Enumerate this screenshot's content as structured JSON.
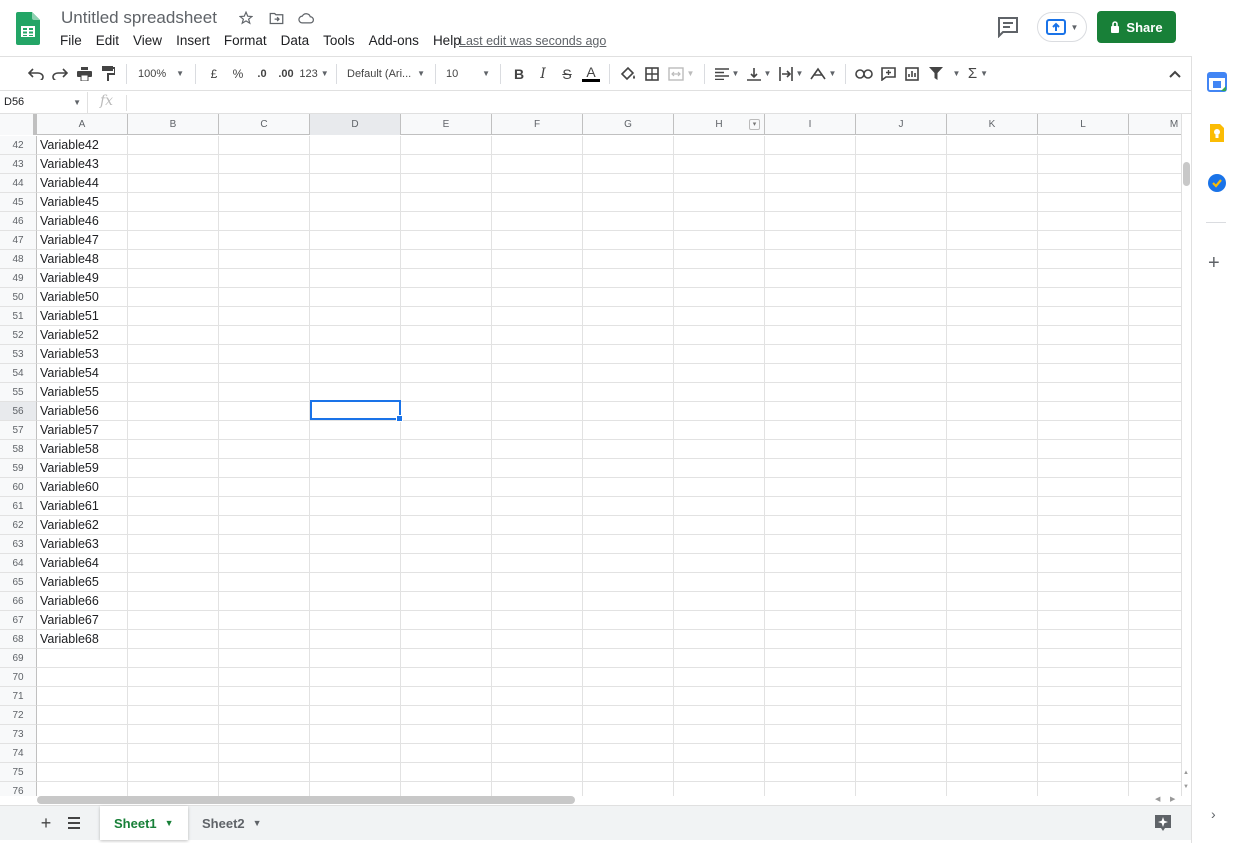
{
  "header": {
    "doc_title": "Untitled spreadsheet",
    "last_edit": "Last edit was seconds ago",
    "share_label": "Share",
    "menu": [
      "File",
      "Edit",
      "View",
      "Insert",
      "Format",
      "Data",
      "Tools",
      "Add-ons",
      "Help"
    ]
  },
  "toolbar": {
    "zoom": "100%",
    "currency": "£",
    "percent": "%",
    "decrease_decimal": ".0",
    "increase_decimal": ".00",
    "more_formats": "123",
    "font": "Default (Ari...",
    "font_size": "10",
    "bold": "B",
    "italic": "I",
    "strike": "S",
    "text_color": "A",
    "sum": "Σ"
  },
  "formula_bar": {
    "name_box": "D56",
    "fx": "fx"
  },
  "grid": {
    "columns": [
      "A",
      "B",
      "C",
      "D",
      "E",
      "F",
      "G",
      "H",
      "I",
      "J",
      "K",
      "L",
      "M"
    ],
    "active_column": "D",
    "filter_column": "H",
    "active_row": 56,
    "rows": [
      {
        "num": "42",
        "a": "Variable42"
      },
      {
        "num": "43",
        "a": "Variable43"
      },
      {
        "num": "44",
        "a": "Variable44"
      },
      {
        "num": "45",
        "a": "Variable45"
      },
      {
        "num": "46",
        "a": "Variable46"
      },
      {
        "num": "47",
        "a": "Variable47"
      },
      {
        "num": "48",
        "a": "Variable48"
      },
      {
        "num": "49",
        "a": "Variable49"
      },
      {
        "num": "50",
        "a": "Variable50"
      },
      {
        "num": "51",
        "a": "Variable51"
      },
      {
        "num": "52",
        "a": "Variable52"
      },
      {
        "num": "53",
        "a": "Variable53"
      },
      {
        "num": "54",
        "a": "Variable54"
      },
      {
        "num": "55",
        "a": "Variable55"
      },
      {
        "num": "56",
        "a": "Variable56"
      },
      {
        "num": "57",
        "a": "Variable57"
      },
      {
        "num": "58",
        "a": "Variable58"
      },
      {
        "num": "59",
        "a": "Variable59"
      },
      {
        "num": "60",
        "a": "Variable60"
      },
      {
        "num": "61",
        "a": "Variable61"
      },
      {
        "num": "62",
        "a": "Variable62"
      },
      {
        "num": "63",
        "a": "Variable63"
      },
      {
        "num": "64",
        "a": "Variable64"
      },
      {
        "num": "65",
        "a": "Variable65"
      },
      {
        "num": "66",
        "a": "Variable66"
      },
      {
        "num": "67",
        "a": "Variable67"
      },
      {
        "num": "68",
        "a": "Variable68"
      },
      {
        "num": "69",
        "a": ""
      },
      {
        "num": "70",
        "a": ""
      },
      {
        "num": "71",
        "a": ""
      },
      {
        "num": "72",
        "a": ""
      },
      {
        "num": "73",
        "a": ""
      },
      {
        "num": "74",
        "a": ""
      },
      {
        "num": "75",
        "a": ""
      },
      {
        "num": "76",
        "a": ""
      }
    ]
  },
  "sheets": [
    {
      "name": "Sheet1",
      "active": true
    },
    {
      "name": "Sheet2",
      "active": false
    }
  ],
  "colors": {
    "brand_green": "#188038",
    "selection_blue": "#1a73e8"
  }
}
